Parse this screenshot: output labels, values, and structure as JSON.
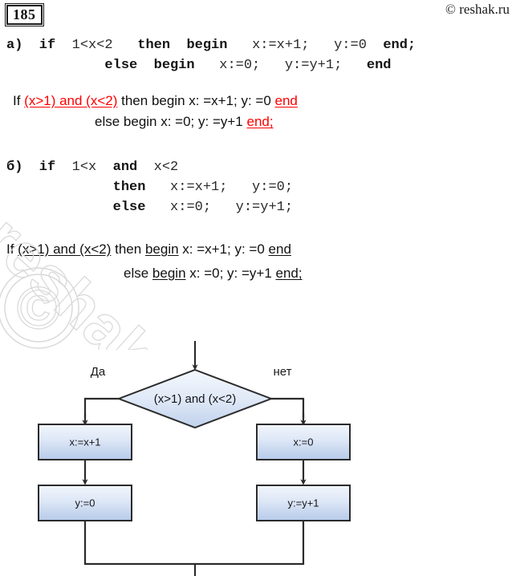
{
  "header": {
    "page_number": "185",
    "copyright": "© reshak.ru"
  },
  "watermark": {
    "text": "reshak.ru",
    "symbol": "©"
  },
  "problems": [
    {
      "id": "a",
      "label": "а)",
      "code_lines": [
        [
          {
            "t": "а)",
            "kw": true
          },
          {
            "t": "  if  ",
            "kw": true
          },
          {
            "t": "1<x<2",
            "kw": false
          },
          {
            "t": "   then  begin ",
            "kw": true
          },
          {
            "t": "  x:=x+1;   y:=0  ",
            "kw": false
          },
          {
            "t": "end;",
            "kw": true
          }
        ],
        [
          {
            "t": "            else  begin ",
            "kw": true
          },
          {
            "t": "  x:=0;   y:=y+1;   ",
            "kw": false
          },
          {
            "t": "end",
            "kw": true
          }
        ]
      ],
      "answer_lines": [
        {
          "indent": 8,
          "parts": [
            {
              "t": "If ",
              "style": "plain"
            },
            {
              "t": "(x>1) and (x<2)",
              "style": "red-underline"
            },
            {
              "t": " then begin x: =x+1; y: =0 ",
              "style": "plain"
            },
            {
              "t": "end",
              "style": "red-underline"
            }
          ]
        },
        {
          "indent": 110,
          "parts": [
            {
              "t": "else begin x: =0; y: =y+1 ",
              "style": "plain"
            },
            {
              "t": "end;",
              "style": "red-underline"
            }
          ]
        }
      ]
    },
    {
      "id": "b",
      "label": "б)",
      "code_lines": [
        [
          {
            "t": "б)",
            "kw": true
          },
          {
            "t": "  if  ",
            "kw": true
          },
          {
            "t": "1<x",
            "kw": false
          },
          {
            "t": "  and  ",
            "kw": true
          },
          {
            "t": "x<2",
            "kw": false
          }
        ],
        [
          {
            "t": "             then ",
            "kw": true
          },
          {
            "t": "  x:=x+1;   y:=0;",
            "kw": false
          }
        ],
        [
          {
            "t": "             else ",
            "kw": true
          },
          {
            "t": "  x:=0;   y:=y+1;",
            "kw": false
          }
        ]
      ],
      "answer_lines": [
        {
          "indent": 4,
          "parts": [
            {
              "t": "If ",
              "style": "plain"
            },
            {
              "t": "(x>1) and (x<2)",
              "style": "underline"
            },
            {
              "t": " then ",
              "style": "plain"
            },
            {
              "t": "begin",
              "style": "underline"
            },
            {
              "t": " x: =x+1; y: =0 ",
              "style": "plain"
            },
            {
              "t": "end",
              "style": "underline"
            }
          ]
        },
        {
          "indent": 150,
          "parts": [
            {
              "t": "else ",
              "style": "plain"
            },
            {
              "t": "begin",
              "style": "underline"
            },
            {
              "t": " x: =0; y: =y+1 ",
              "style": "plain"
            },
            {
              "t": "end;",
              "style": "underline"
            }
          ]
        }
      ]
    }
  ],
  "flowchart": {
    "condition": "(x>1) and (x<2)",
    "yes_label": "Да",
    "no_label": "нет",
    "yes_branch": [
      "x:=x+1",
      "y:=0"
    ],
    "no_branch": [
      "x:=0",
      "y:=y+1"
    ],
    "colors": {
      "box_fill_top": "#eaf1fb",
      "box_fill_bottom": "#b9ccea",
      "stroke": "#2b2b2b"
    }
  }
}
